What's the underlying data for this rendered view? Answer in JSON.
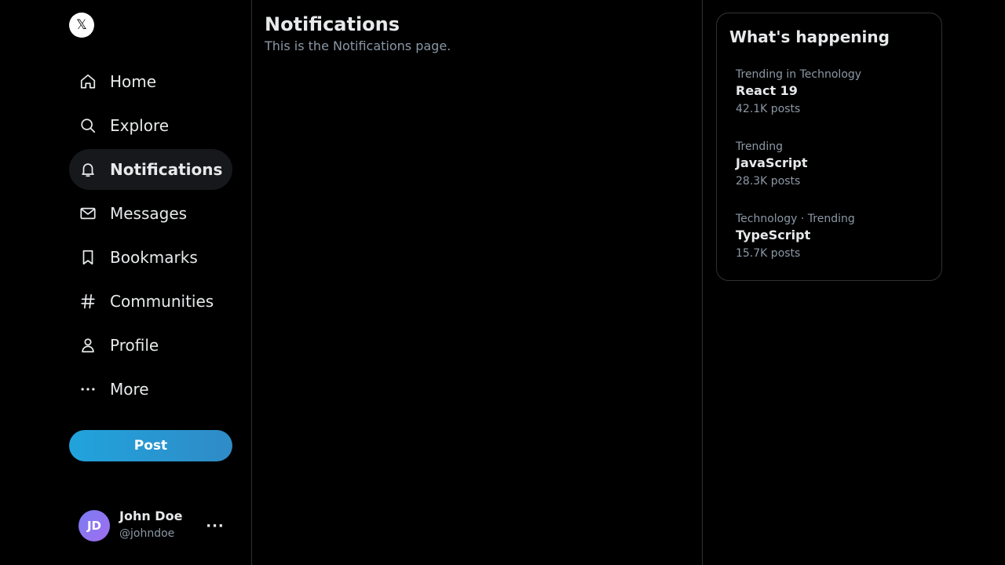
{
  "logo": {
    "glyph": "𝕏"
  },
  "sidebar": {
    "items": [
      {
        "label": "Home",
        "icon": "home-icon",
        "active": false
      },
      {
        "label": "Explore",
        "icon": "search-icon",
        "active": false
      },
      {
        "label": "Notifications",
        "icon": "bell-icon",
        "active": true
      },
      {
        "label": "Messages",
        "icon": "envelope-icon",
        "active": false
      },
      {
        "label": "Bookmarks",
        "icon": "bookmark-icon",
        "active": false
      },
      {
        "label": "Communities",
        "icon": "hashtag-icon",
        "active": false
      },
      {
        "label": "Profile",
        "icon": "person-icon",
        "active": false
      },
      {
        "label": "More",
        "icon": "more-dots-icon",
        "active": false
      }
    ],
    "post_label": "Post"
  },
  "account": {
    "initials": "JD",
    "name": "John Doe",
    "handle": "@johndoe",
    "more": "···"
  },
  "main": {
    "title": "Notifications",
    "description": "This is the Notifications page."
  },
  "trends": {
    "title": "What's happening",
    "items": [
      {
        "context": "Trending in Technology",
        "name": "React 19",
        "count": "42.1K posts"
      },
      {
        "context": "Trending",
        "name": "JavaScript",
        "count": "28.3K posts"
      },
      {
        "context": "Technology · Trending",
        "name": "TypeScript",
        "count": "15.7K posts"
      }
    ]
  },
  "colors": {
    "background": "#000000",
    "text": "#e7e9ea",
    "muted": "#8b98a5",
    "border": "#2f3336",
    "accent": "#1d9bf0",
    "active_nav_bg": "#16181c"
  }
}
